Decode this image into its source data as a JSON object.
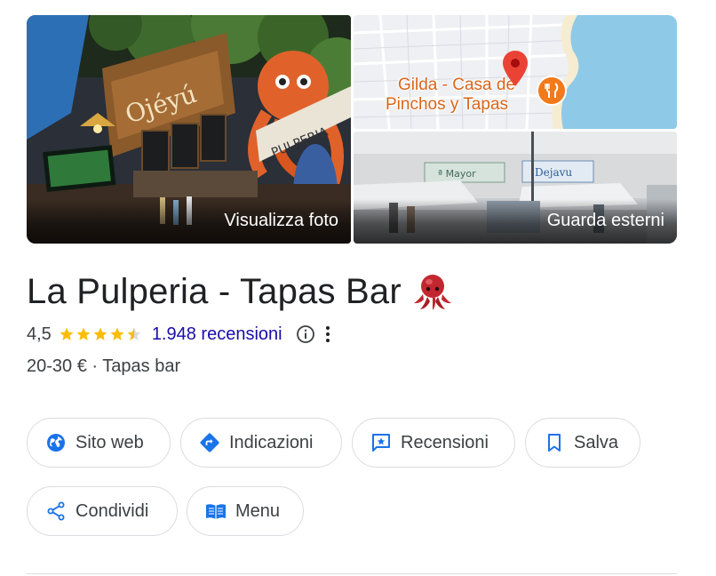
{
  "photos": {
    "main_caption": "Visualizza foto",
    "street_caption": "Guarda esterni",
    "map": {
      "place_label_line1": "Gilda - Casa de",
      "place_label_line2": "Pinchos y Tapas",
      "pin_icon": "map-pin-icon",
      "restaurant_icon": "fork-knife-icon"
    }
  },
  "place": {
    "name": "La Pulperia - Tapas Bar",
    "emoji_icon": "octopus-icon",
    "rating": "4,5",
    "stars": 4.5,
    "reviews_label": "1.948 recensioni",
    "price_range": "20-30 €",
    "separator": "·",
    "category": "Tapas bar"
  },
  "actions": {
    "website": "Sito web",
    "directions": "Indicazioni",
    "reviews": "Recensioni",
    "save": "Salva",
    "share": "Condividi",
    "menu": "Menu"
  },
  "colors": {
    "accent_blue": "#1a73e8",
    "link_blue": "#1a0dab",
    "star_gold": "#fbbc04",
    "map_label_orange": "#d9641c",
    "chip_border": "#dadce0"
  }
}
